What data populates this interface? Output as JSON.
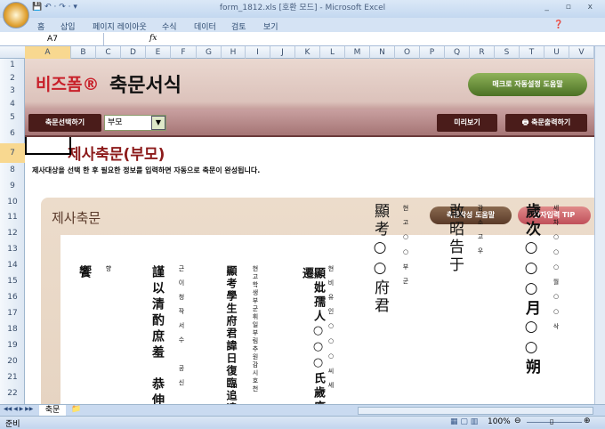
{
  "window": {
    "title": "form_1812.xls  [호환 모드] - Microsoft Excel",
    "controls": "_ ▫ x",
    "qat": "💾 ↶ · ↷ · ▾"
  },
  "ribbon": {
    "tabs": [
      "홈",
      "삽입",
      "페이지 레이아웃",
      "수식",
      "데이터",
      "검토",
      "보기"
    ]
  },
  "formula_bar": {
    "name_box": "A7",
    "fx": "fx",
    "value": ""
  },
  "columns": [
    "A",
    "B",
    "C",
    "D",
    "E",
    "F",
    "G",
    "H",
    "I",
    "J",
    "K",
    "L",
    "M",
    "N",
    "O",
    "P",
    "Q",
    "R",
    "S",
    "T",
    "U",
    "V"
  ],
  "rows": [
    "1",
    "2",
    "3",
    "4",
    "5",
    "6",
    "7",
    "8",
    "9",
    "10",
    "11",
    "12",
    "13",
    "14",
    "15",
    "16",
    "17",
    "18",
    "19",
    "20",
    "21",
    "22"
  ],
  "banner": {
    "logo": "비즈폼®",
    "title": "축문서식",
    "macro_help": "매크로 자동설정 도움말",
    "select_button": "축문선택하기",
    "select_value": "부모",
    "preview_button": "미리보기",
    "print_button": "축문출력하기"
  },
  "heading": {
    "title": "제사축문(부모)",
    "description": "제사대상을 선택 한 후 필요한 정보를 입력하면 자동으로 축문이 완성됩니다."
  },
  "panel": {
    "title": "제사축문",
    "help_button": "축문작성 도움말",
    "hanja_button": "한자입력 TIP"
  },
  "document": {
    "columns": [
      {
        "hanja": "歲次○○○月○○朔",
        "hangul": "세차○○○월○○삭"
      },
      {
        "hanja": "敢昭告于",
        "hangul": "감소고우"
      },
      {
        "hanja": "顯考○○府君",
        "hangul": "현고○○부군"
      },
      {
        "hanja": "顯妣孺人○○○氏歲序遷",
        "hangul": "현비유인○○○씨세"
      },
      {
        "hanja": "顯考學生府君諱日復臨追遠",
        "hangul": "현고학생부군휘일부림추원감시호천"
      },
      {
        "hanja": "謹以清酌庶羞　恭伸奠",
        "hangul": "근이청작서수　공신"
      },
      {
        "hanja": "饗",
        "hangul": "향"
      }
    ]
  },
  "sheet_tabs": {
    "active": "축문",
    "nav": "◀◀ ◀ ▶ ▶▶"
  },
  "status": {
    "ready": "준비",
    "zoom": "100%"
  }
}
